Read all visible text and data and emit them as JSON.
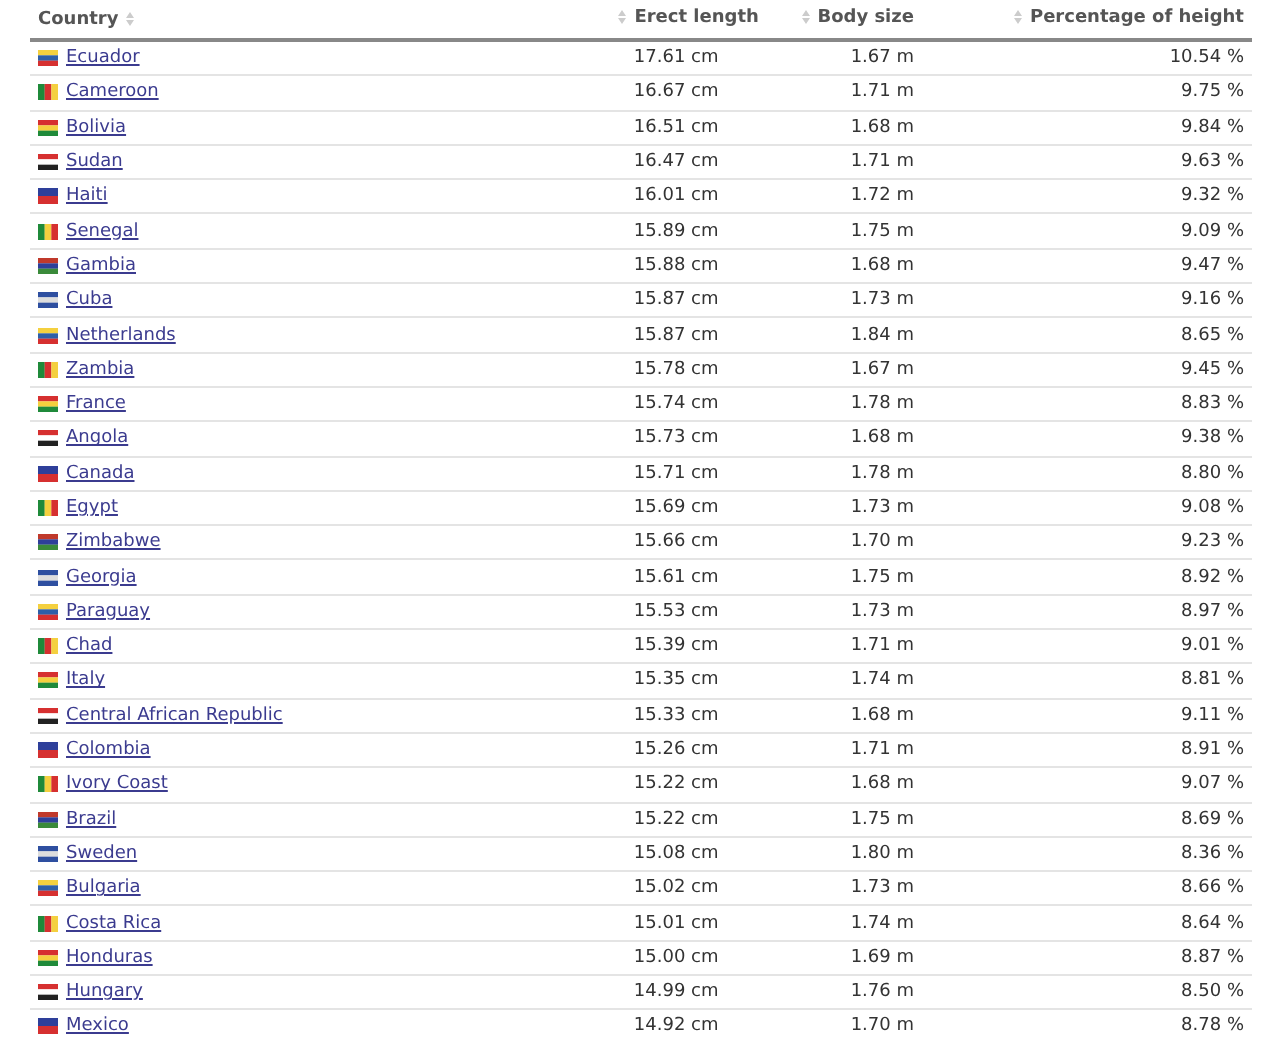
{
  "table": {
    "columns": [
      "Country",
      "Erect length",
      "Body size",
      "Percentage of height"
    ],
    "rows": [
      {
        "country": "Ecuador",
        "erect_length": "17.61 cm",
        "body_size": "1.67 m",
        "percentage": "10.54 %"
      },
      {
        "country": "Cameroon",
        "erect_length": "16.67 cm",
        "body_size": "1.71 m",
        "percentage": "9.75 %"
      },
      {
        "country": "Bolivia",
        "erect_length": "16.51 cm",
        "body_size": "1.68 m",
        "percentage": "9.84 %"
      },
      {
        "country": "Sudan",
        "erect_length": "16.47 cm",
        "body_size": "1.71 m",
        "percentage": "9.63 %"
      },
      {
        "country": "Haiti",
        "erect_length": "16.01 cm",
        "body_size": "1.72 m",
        "percentage": "9.32 %"
      },
      {
        "country": "Senegal",
        "erect_length": "15.89 cm",
        "body_size": "1.75 m",
        "percentage": "9.09 %"
      },
      {
        "country": "Gambia",
        "erect_length": "15.88 cm",
        "body_size": "1.68 m",
        "percentage": "9.47 %"
      },
      {
        "country": "Cuba",
        "erect_length": "15.87 cm",
        "body_size": "1.73 m",
        "percentage": "9.16 %"
      },
      {
        "country": "Netherlands",
        "erect_length": "15.87 cm",
        "body_size": "1.84 m",
        "percentage": "8.65 %"
      },
      {
        "country": "Zambia",
        "erect_length": "15.78 cm",
        "body_size": "1.67 m",
        "percentage": "9.45 %"
      },
      {
        "country": "France",
        "erect_length": "15.74 cm",
        "body_size": "1.78 m",
        "percentage": "8.83 %"
      },
      {
        "country": "Angola",
        "erect_length": "15.73 cm",
        "body_size": "1.68 m",
        "percentage": "9.38 %"
      },
      {
        "country": "Canada",
        "erect_length": "15.71 cm",
        "body_size": "1.78 m",
        "percentage": "8.80 %"
      },
      {
        "country": "Egypt",
        "erect_length": "15.69 cm",
        "body_size": "1.73 m",
        "percentage": "9.08 %"
      },
      {
        "country": "Zimbabwe",
        "erect_length": "15.66 cm",
        "body_size": "1.70 m",
        "percentage": "9.23 %"
      },
      {
        "country": "Georgia",
        "erect_length": "15.61 cm",
        "body_size": "1.75 m",
        "percentage": "8.92 %"
      },
      {
        "country": "Paraguay",
        "erect_length": "15.53 cm",
        "body_size": "1.73 m",
        "percentage": "8.97 %"
      },
      {
        "country": "Chad",
        "erect_length": "15.39 cm",
        "body_size": "1.71 m",
        "percentage": "9.01 %"
      },
      {
        "country": "Italy",
        "erect_length": "15.35 cm",
        "body_size": "1.74 m",
        "percentage": "8.81 %"
      },
      {
        "country": "Central African Republic",
        "erect_length": "15.33 cm",
        "body_size": "1.68 m",
        "percentage": "9.11 %"
      },
      {
        "country": "Colombia",
        "erect_length": "15.26 cm",
        "body_size": "1.71 m",
        "percentage": "8.91 %"
      },
      {
        "country": "Ivory Coast",
        "erect_length": "15.22 cm",
        "body_size": "1.68 m",
        "percentage": "9.07 %"
      },
      {
        "country": "Brazil",
        "erect_length": "15.22 cm",
        "body_size": "1.75 m",
        "percentage": "8.69 %"
      },
      {
        "country": "Sweden",
        "erect_length": "15.08 cm",
        "body_size": "1.80 m",
        "percentage": "8.36 %"
      },
      {
        "country": "Bulgaria",
        "erect_length": "15.02 cm",
        "body_size": "1.73 m",
        "percentage": "8.66 %"
      },
      {
        "country": "Costa Rica",
        "erect_length": "15.01 cm",
        "body_size": "1.74 m",
        "percentage": "8.64 %"
      },
      {
        "country": "Honduras",
        "erect_length": "15.00 cm",
        "body_size": "1.69 m",
        "percentage": "8.87 %"
      },
      {
        "country": "Hungary",
        "erect_length": "14.99 cm",
        "body_size": "1.76 m",
        "percentage": "8.50 %"
      },
      {
        "country": "Mexico",
        "erect_length": "14.92 cm",
        "body_size": "1.70 m",
        "percentage": "8.78 %"
      }
    ]
  }
}
